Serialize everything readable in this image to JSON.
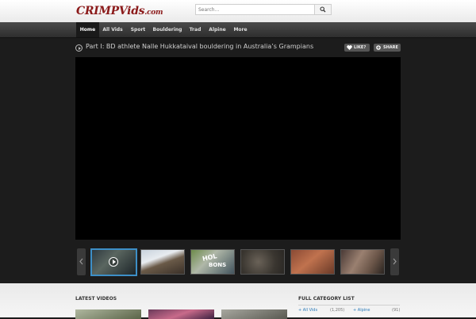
{
  "header": {
    "logo": {
      "part1": "CRIMP",
      "part2": "Vids",
      "part3": ".com"
    },
    "search": {
      "placeholder": "Search..."
    }
  },
  "nav": {
    "items": [
      {
        "label": "Home",
        "active": true
      },
      {
        "label": "All Vids"
      },
      {
        "label": "Sport"
      },
      {
        "label": "Bouldering"
      },
      {
        "label": "Trad"
      },
      {
        "label": "Alpine"
      },
      {
        "label": "More"
      }
    ]
  },
  "video": {
    "title": "Part I: BD athlete Nalle Hukkataival bouldering in Australia’s Grampians",
    "like_label": "LIKE?",
    "share_label": "SHARE"
  },
  "thumb_overlay": {
    "text1": "HOL",
    "text2": "BONS"
  },
  "sections": {
    "latest_videos": "LATEST VIDEOS",
    "full_category_list": "FULL CATEGORY LIST"
  },
  "categories": [
    {
      "name": "All Vids",
      "count": "(1,205)"
    },
    {
      "name": "Alpine",
      "count": "(91)"
    }
  ],
  "icons": {
    "search": "search-icon",
    "like": "heart-icon",
    "share": "share-plus-icon",
    "prev": "chevron-left-icon",
    "next": "chevron-right-icon",
    "play": "play-circle-icon"
  },
  "colors": {
    "brand": "#8b1a1a",
    "accent": "#3d8fc7",
    "link": "#2b7bb9"
  }
}
